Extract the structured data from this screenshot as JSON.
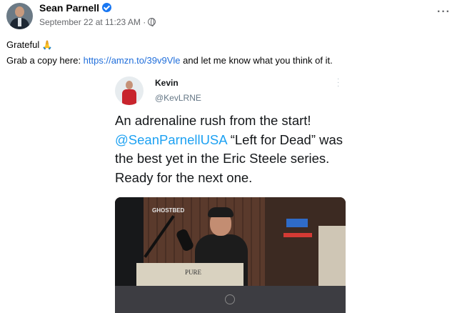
{
  "post": {
    "author": "Sean Parnell",
    "timestamp": "September 22 at 11:23 AM",
    "separator": "·",
    "more_options": "···",
    "line1_text": "Grateful",
    "line1_emoji": "🙏",
    "line2_prefix": "Grab a copy here: ",
    "link": "https://amzn.to/39v9Vle",
    "line2_suffix": " and let me know what you think of it."
  },
  "tweet": {
    "name": "Kevin",
    "handle": "@KevLRNE",
    "text_part1": "An adrenaline rush from the start! ",
    "mention": "@SeanParnellUSA",
    "text_part2": " “Left for Dead” was the best yet in the Eric Steele series. Ready for the next one."
  },
  "video_frame": {
    "sign_text": "GHOSTBED",
    "book_label": "PURE"
  },
  "colors": {
    "link": "#216fdb",
    "verified": "#1877f2",
    "mention": "#1da1f2"
  }
}
